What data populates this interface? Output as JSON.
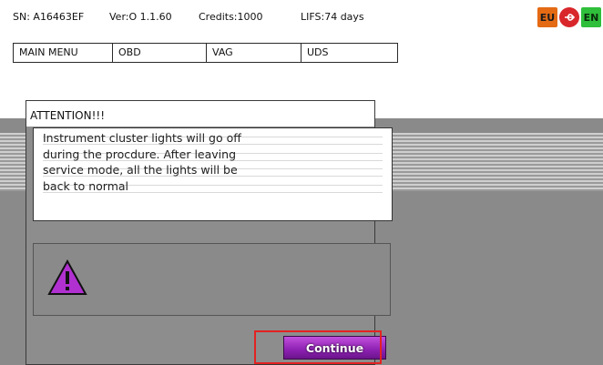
{
  "status": {
    "serial": "SN: A16463EF",
    "version": "Ver:O 1.1.60",
    "credits": "Credits:1000",
    "life": "LIFS:74 days",
    "region_badge": "EU",
    "language_badge": "EN",
    "usb_icon": "usb-icon"
  },
  "menu": {
    "tabs": [
      {
        "label": "MAIN MENU"
      },
      {
        "label": "OBD"
      },
      {
        "label": "VAG"
      },
      {
        "label": "UDS"
      }
    ]
  },
  "dialog": {
    "title": "ATTENTION!!!",
    "message_lines": [
      "Instrument cluster lights will go off",
      "during the procdure. After leaving",
      "service mode, all the lights will be",
      "back to normal"
    ],
    "icon": "warning-icon",
    "continue_label": "Continue"
  },
  "colors": {
    "accent_button": "#8d21b2",
    "warning_icon": "#b030d0",
    "highlight": "#e32222"
  }
}
